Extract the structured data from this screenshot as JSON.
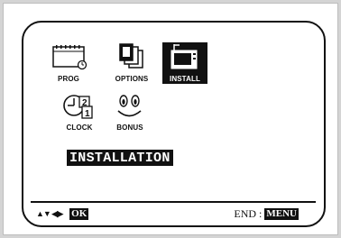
{
  "menu": {
    "items": [
      {
        "label": "PROG",
        "icon": "calendar-clock-icon"
      },
      {
        "label": "OPTIONS",
        "icon": "stacked-pages-icon"
      },
      {
        "label": "INSTALL",
        "icon": "tv-antenna-icon",
        "selected": true
      },
      {
        "label": "CLOCK",
        "icon": "clock-calendar-icon"
      },
      {
        "label": "BONUS",
        "icon": "smiley-face-icon"
      }
    ]
  },
  "title": "INSTALLATION",
  "footer": {
    "nav_arrows": "▲▼ ◀▶",
    "ok_label": "OK",
    "end_label": "END :",
    "menu_label": "MENU"
  },
  "colors": {
    "ink": "#111111",
    "screen": "#ffffff",
    "bezel": "#d4d4d4"
  }
}
